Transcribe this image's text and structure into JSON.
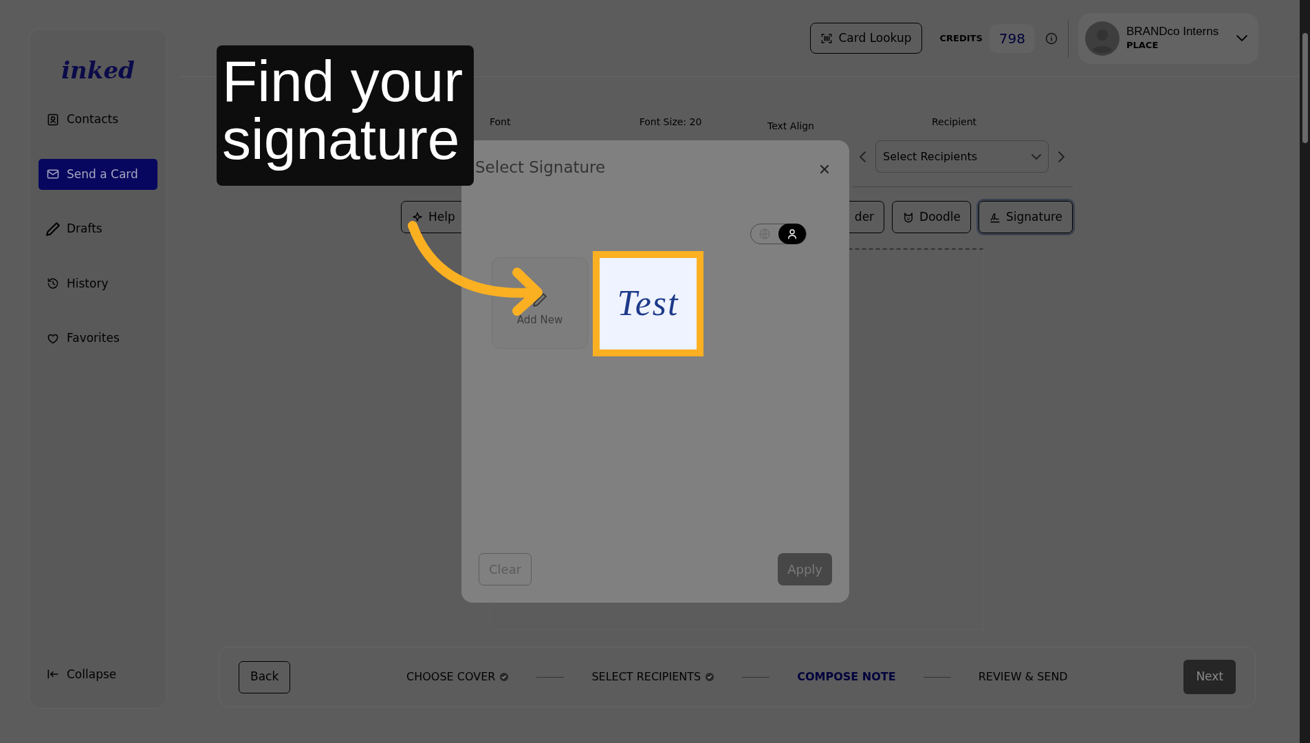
{
  "sidebar": {
    "logo": "inked",
    "items": [
      {
        "label": "Contacts",
        "selected": false
      },
      {
        "label": "Send a Card",
        "selected": true
      },
      {
        "label": "Drafts",
        "selected": false
      },
      {
        "label": "History",
        "selected": false
      },
      {
        "label": "Favorites",
        "selected": false
      }
    ],
    "collapse": "Collapse"
  },
  "header": {
    "card_lookup": "Card Lookup",
    "credits_label": "CREDITS",
    "credits": "798",
    "user": {
      "name": "BRANDco Interns",
      "role": "PLACE"
    }
  },
  "editor": {
    "font_label": "Font",
    "font_size_label": "Font Size: 20",
    "text_align_label": "Text Align",
    "recipient_label": "Recipient",
    "recipient_placeholder": "Select Recipients",
    "tools": [
      {
        "label": "Help",
        "kind": "help",
        "selected": false
      },
      {
        "label": "der",
        "kind": "hidden",
        "selected": false
      },
      {
        "label": "Doodle",
        "kind": "doodle",
        "selected": false
      },
      {
        "label": "Signature",
        "kind": "signature",
        "selected": true
      }
    ]
  },
  "modal": {
    "title": "Select Signature",
    "scope_toggle": [
      {
        "kind": "globe",
        "selected": false
      },
      {
        "kind": "person",
        "selected": true
      }
    ],
    "add_new": "Add New",
    "signatures": [
      {
        "text": "Test",
        "highlighted": true
      }
    ],
    "buttons": [
      "Clear",
      "Apply"
    ]
  },
  "steps": {
    "back": "Back",
    "items": [
      {
        "label": "CHOOSE COVER",
        "done": true,
        "selected": false
      },
      {
        "label": "SELECT RECIPIENTS",
        "done": true,
        "selected": false
      },
      {
        "label": "COMPOSE NOTE",
        "done": false,
        "selected": true
      },
      {
        "label": "REVIEW & SEND",
        "done": false,
        "selected": false
      }
    ],
    "next": "Next"
  },
  "callout": {
    "text": "Find your signature"
  }
}
